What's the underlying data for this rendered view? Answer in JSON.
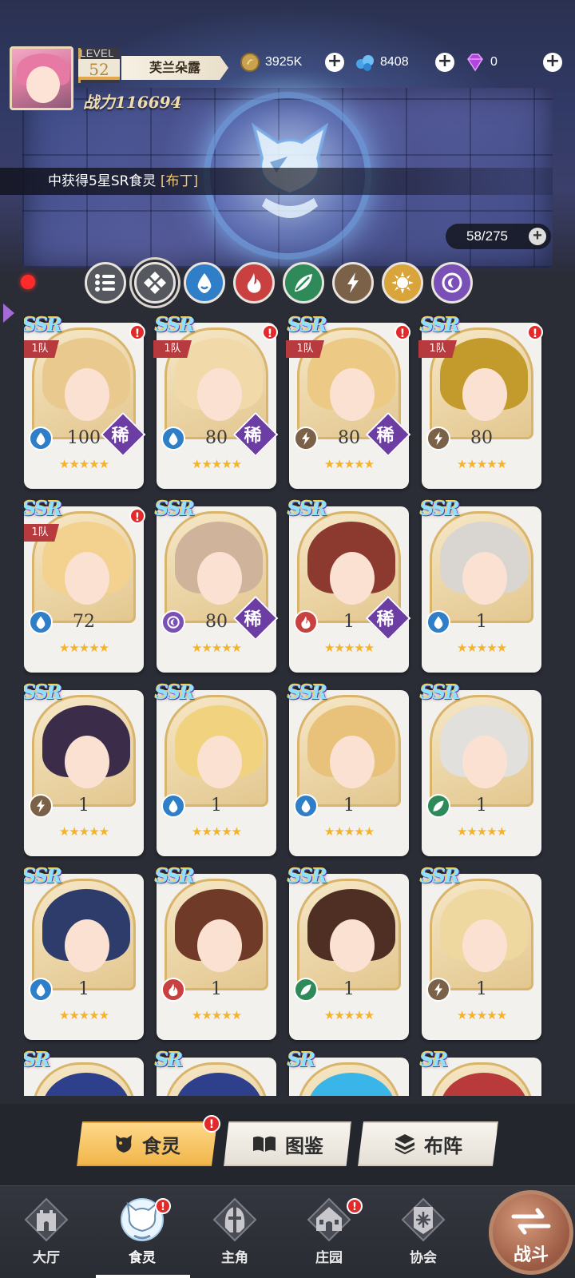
{
  "player": {
    "level_label": "LEVEL",
    "level": "52",
    "name": "芙兰朵露",
    "power": "战力116694"
  },
  "resources": {
    "gold": "3925K",
    "crystal": "8408",
    "diamond": "0"
  },
  "news": {
    "prefix": "中获得5星SR食灵",
    "highlight": "[布丁]"
  },
  "collection_count": "58/275",
  "filters": [
    {
      "name": "all",
      "icon": "list-icon"
    },
    {
      "name": "grid",
      "icon": "diamond-grid-icon"
    },
    {
      "name": "water",
      "icon": "water-drop-icon",
      "color": "#2f7fc8"
    },
    {
      "name": "fire",
      "icon": "fire-icon",
      "color": "#c94040"
    },
    {
      "name": "wind",
      "icon": "leaf-icon",
      "color": "#2f8a5a"
    },
    {
      "name": "thunder",
      "icon": "lightning-icon",
      "color": "#7a6148"
    },
    {
      "name": "light",
      "icon": "sun-icon",
      "color": "#d9a43a"
    },
    {
      "name": "dark",
      "icon": "moon-icon",
      "color": "#7a4fb6"
    }
  ],
  "cards": [
    {
      "grade": "SSR",
      "team": "1队",
      "level": "100",
      "element": "water",
      "rare": "稀",
      "alert": "!",
      "hair": "#e9c98e"
    },
    {
      "grade": "SSR",
      "team": "1队",
      "level": "80",
      "element": "water",
      "rare": "稀",
      "alert": "!",
      "hair": "#f1d9a9"
    },
    {
      "grade": "SSR",
      "team": "1队",
      "level": "80",
      "element": "thunder",
      "rare": "稀",
      "alert": "!",
      "hair": "#ecca86"
    },
    {
      "grade": "SSR",
      "team": "1队",
      "level": "80",
      "element": "thunder",
      "rare": "",
      "alert": "!",
      "hair": "#c39a2c"
    },
    {
      "grade": "SSR",
      "team": "1队",
      "level": "72",
      "element": "water",
      "rare": "",
      "alert": "!",
      "hair": "#f2d28e"
    },
    {
      "grade": "SSR",
      "team": "",
      "level": "80",
      "element": "dark",
      "rare": "稀",
      "alert": "",
      "hair": "#cfb49b"
    },
    {
      "grade": "SSR",
      "team": "",
      "level": "1",
      "element": "fire",
      "rare": "稀",
      "alert": "",
      "hair": "#8c3a30"
    },
    {
      "grade": "SSR",
      "team": "",
      "level": "1",
      "element": "water",
      "rare": "",
      "alert": "",
      "hair": "#d9d6d2"
    },
    {
      "grade": "SSR",
      "team": "",
      "level": "1",
      "element": "thunder",
      "rare": "",
      "alert": "",
      "hair": "#3b2d4a"
    },
    {
      "grade": "SSR",
      "team": "",
      "level": "1",
      "element": "water",
      "rare": "",
      "alert": "",
      "hair": "#f1d27e"
    },
    {
      "grade": "SSR",
      "team": "",
      "level": "1",
      "element": "water",
      "rare": "",
      "alert": "",
      "hair": "#e8c27a"
    },
    {
      "grade": "SSR",
      "team": "",
      "level": "1",
      "element": "wind",
      "rare": "",
      "alert": "",
      "hair": "#e2e0dc"
    },
    {
      "grade": "SSR",
      "team": "",
      "level": "1",
      "element": "water",
      "rare": "",
      "alert": "",
      "hair": "#2e3c6c"
    },
    {
      "grade": "SSR",
      "team": "",
      "level": "1",
      "element": "fire",
      "rare": "",
      "alert": "",
      "hair": "#6f3b28"
    },
    {
      "grade": "SSR",
      "team": "",
      "level": "1",
      "element": "wind",
      "rare": "",
      "alert": "",
      "hair": "#4f2e24"
    },
    {
      "grade": "SSR",
      "team": "",
      "level": "1",
      "element": "thunder",
      "rare": "",
      "alert": "",
      "hair": "#eed8a0"
    },
    {
      "grade": "SR",
      "team": "",
      "level": "",
      "element": "",
      "rare": "",
      "alert": "",
      "hair": "#2e3f8c"
    },
    {
      "grade": "SR",
      "team": "",
      "level": "",
      "element": "",
      "rare": "",
      "alert": "",
      "hair": "#2e3f8c"
    },
    {
      "grade": "SR",
      "team": "",
      "level": "",
      "element": "",
      "rare": "",
      "alert": "",
      "hair": "#39b5e8"
    },
    {
      "grade": "SR",
      "team": "",
      "level": "",
      "element": "",
      "rare": "",
      "alert": "",
      "hair": "#b83a3a"
    }
  ],
  "stars": "★★★★★",
  "subtabs": {
    "spirits": "食灵",
    "spirits_alert": "!",
    "codex": "图鉴",
    "formation": "布阵"
  },
  "nav": {
    "lobby": "大厅",
    "spirits": "食灵",
    "hero": "主角",
    "manor": "庄园",
    "guild": "协会",
    "battle": "战斗",
    "alert": "!"
  },
  "colors": {
    "water": "#2f7fc8",
    "fire": "#c94040",
    "wind": "#2f8a5a",
    "thunder": "#7a6148",
    "dark": "#7a4fb6",
    "light": "#d9a43a"
  }
}
